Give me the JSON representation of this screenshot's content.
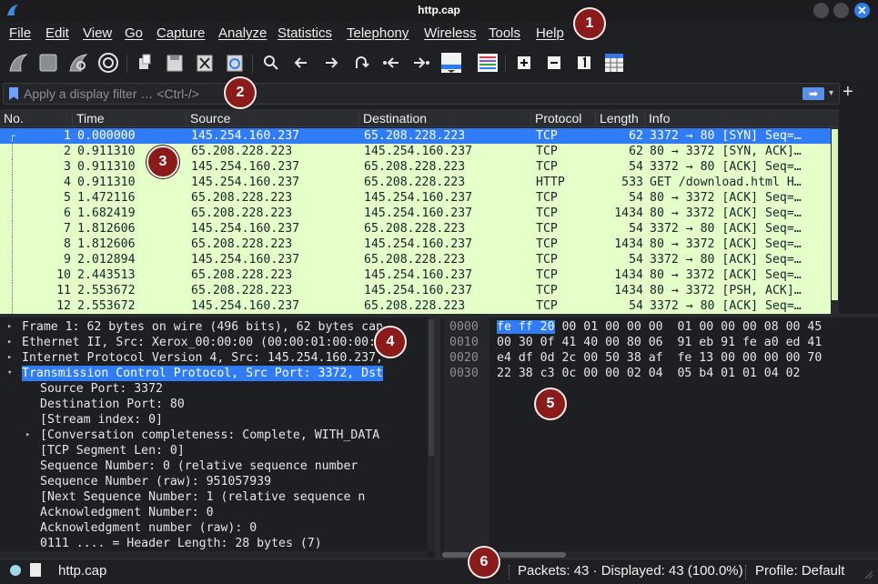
{
  "window": {
    "title": "http.cap",
    "close_glyph": "✕"
  },
  "menu": [
    "File",
    "Edit",
    "View",
    "Go",
    "Capture",
    "Analyze",
    "Statistics",
    "Telephony",
    "Wireless",
    "Tools",
    "Help"
  ],
  "toolbar_icons": [
    "start-capture-icon",
    "stop-capture-icon",
    "restart-capture-icon",
    "capture-options-icon",
    "open-file-icon",
    "save-file-icon",
    "close-file-icon",
    "reload-file-icon",
    "find-packet-icon",
    "go-back-icon",
    "go-forward-icon",
    "go-to-packet-icon",
    "first-packet-icon",
    "last-packet-icon",
    "autoscroll-icon",
    "colorize-icon",
    "zoom-in-icon",
    "zoom-out-icon",
    "normal-size-icon",
    "resize-columns-icon"
  ],
  "filter": {
    "placeholder": "Apply a display filter … <Ctrl-/>",
    "apply_glyph": "➡",
    "dropdown_glyph": "▾",
    "add_glyph": "+"
  },
  "packet_list": {
    "columns": [
      "No.",
      "Time",
      "Source",
      "Destination",
      "Protocol",
      "Length",
      "Info"
    ],
    "rows": [
      [
        "1",
        "0.000000",
        "145.254.160.237",
        "65.208.228.223",
        "TCP",
        "62",
        "3372 → 80 [SYN] Seq=…"
      ],
      [
        "2",
        "0.911310",
        "65.208.228.223",
        "145.254.160.237",
        "TCP",
        "62",
        "80 → 3372 [SYN, ACK]…"
      ],
      [
        "3",
        "0.911310",
        "145.254.160.237",
        "65.208.228.223",
        "TCP",
        "54",
        "3372 → 80 [ACK] Seq=…"
      ],
      [
        "4",
        "0.911310",
        "145.254.160.237",
        "65.208.228.223",
        "HTTP",
        "533",
        "GET /download.html H…"
      ],
      [
        "5",
        "1.472116",
        "65.208.228.223",
        "145.254.160.237",
        "TCP",
        "54",
        "80 → 3372 [ACK] Seq=…"
      ],
      [
        "6",
        "1.682419",
        "65.208.228.223",
        "145.254.160.237",
        "TCP",
        "1434",
        "80 → 3372 [ACK] Seq=…"
      ],
      [
        "7",
        "1.812606",
        "145.254.160.237",
        "65.208.228.223",
        "TCP",
        "54",
        "3372 → 80 [ACK] Seq=…"
      ],
      [
        "8",
        "1.812606",
        "65.208.228.223",
        "145.254.160.237",
        "TCP",
        "1434",
        "80 → 3372 [ACK] Seq=…"
      ],
      [
        "9",
        "2.012894",
        "145.254.160.237",
        "65.208.228.223",
        "TCP",
        "54",
        "3372 → 80 [ACK] Seq=…"
      ],
      [
        "10",
        "2.443513",
        "65.208.228.223",
        "145.254.160.237",
        "TCP",
        "1434",
        "80 → 3372 [ACK] Seq=…"
      ],
      [
        "11",
        "2.553672",
        "65.208.228.223",
        "145.254.160.237",
        "TCP",
        "1434",
        "80 → 3372 [PSH, ACK]…"
      ],
      [
        "12",
        "2.553672",
        "145.254.160.237",
        "65.208.228.223",
        "TCP",
        "54",
        "3372 → 80 [ACK] Seq=…"
      ]
    ],
    "selected_row": 0
  },
  "details": [
    {
      "text": "Frame 1: 62 bytes on wire (496 bits), 62 bytes cap",
      "arrow": "▸",
      "indent": 0,
      "selected": false
    },
    {
      "text": "Ethernet II, Src: Xerox_00:00:00 (00:00:01:00:00:0",
      "arrow": "▸",
      "indent": 0,
      "selected": false
    },
    {
      "text": "Internet Protocol Version 4, Src: 145.254.160.237,",
      "arrow": "▸",
      "indent": 0,
      "selected": false
    },
    {
      "text": "Transmission Control Protocol, Src Port: 3372, Dst",
      "arrow": "▾",
      "indent": 0,
      "selected": true
    },
    {
      "text": "Source Port: 3372",
      "arrow": "",
      "indent": 1,
      "selected": false
    },
    {
      "text": "Destination Port: 80",
      "arrow": "",
      "indent": 1,
      "selected": false
    },
    {
      "text": "[Stream index: 0]",
      "arrow": "",
      "indent": 1,
      "selected": false
    },
    {
      "text": "[Conversation completeness: Complete, WITH_DATA",
      "arrow": "▸",
      "indent": 1,
      "selected": false
    },
    {
      "text": "[TCP Segment Len: 0]",
      "arrow": "",
      "indent": 1,
      "selected": false
    },
    {
      "text": "Sequence Number: 0    (relative sequence number",
      "arrow": "",
      "indent": 1,
      "selected": false
    },
    {
      "text": "Sequence Number (raw): 951057939",
      "arrow": "",
      "indent": 1,
      "selected": false
    },
    {
      "text": "[Next Sequence Number: 1    (relative sequence n",
      "arrow": "",
      "indent": 1,
      "selected": false
    },
    {
      "text": "Acknowledgment Number: 0",
      "arrow": "",
      "indent": 1,
      "selected": false
    },
    {
      "text": "Acknowledgment number (raw): 0",
      "arrow": "",
      "indent": 1,
      "selected": false
    },
    {
      "text": "0111 .... = Header Length: 28 bytes (7)",
      "arrow": "",
      "indent": 1,
      "selected": false
    }
  ],
  "bytes": [
    {
      "offset": "0000",
      "hl": "fe ff 20",
      "hex": " 00 01 00 00 00  01 00 00 00 08 00 45"
    },
    {
      "offset": "0010",
      "hl": "",
      "hex": "00 30 0f 41 40 00 80 06  91 eb 91 fe a0 ed 41"
    },
    {
      "offset": "0020",
      "hl": "",
      "hex": "e4 df 0d 2c 00 50 38 af  fe 13 00 00 00 00 70"
    },
    {
      "offset": "0030",
      "hl": "",
      "hex": "22 38 c3 0c 00 00 02 04  05 b4 01 01 04 02"
    }
  ],
  "status": {
    "file": "http.cap",
    "packets": "Packets: 43 · Displayed: 43 (100.0%)",
    "profile": "Profile: Default"
  },
  "markers": [
    "1",
    "2",
    "3",
    "4",
    "5",
    "6"
  ],
  "colors": {
    "selection": "#2f7cf6",
    "tcp_row": "#e4ffc7",
    "marker": "#8b1a1a"
  }
}
